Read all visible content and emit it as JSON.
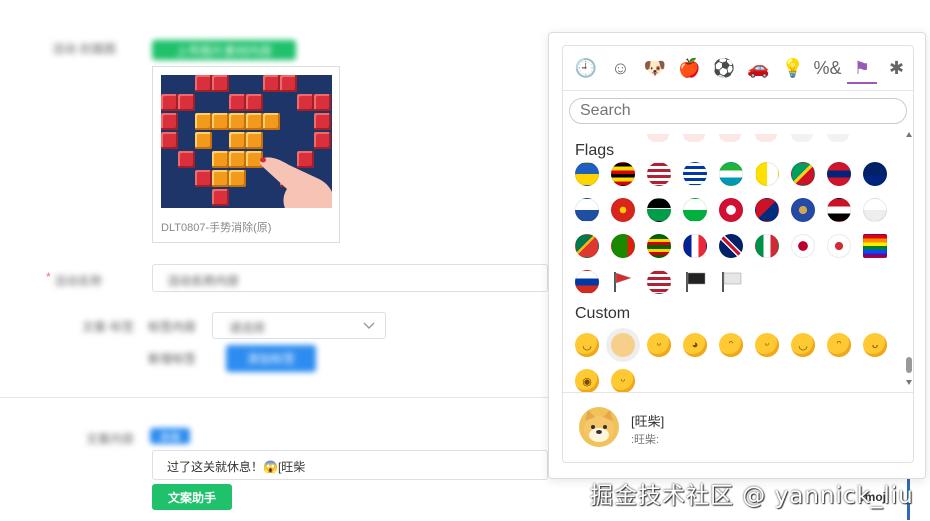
{
  "form": {
    "row1_label": "活动·封面图",
    "row1_button": "上传图片素材内容",
    "card_caption": "DLT0807-手势消除(原)",
    "row2_label": "活动名称",
    "row2_value": "活动名称内容",
    "row3_label": "文案·标签",
    "row3_text": "标签内容",
    "row3_select": "请选择",
    "row4_text": "新增标签",
    "row4_button": "添加标签",
    "row5_label": "文案内容",
    "row5_chip": "表情",
    "textarea_value": "过了这关就休息！😱[旺柴",
    "copy_assist_button": "文案助手",
    "emoji_tag": "emoji"
  },
  "emoji_panel": {
    "search_placeholder": "Search",
    "categories": [
      {
        "name": "recent",
        "glyph": "🕘"
      },
      {
        "name": "smileys",
        "glyph": "☺"
      },
      {
        "name": "animals",
        "glyph": "🐶"
      },
      {
        "name": "food",
        "glyph": "🍎"
      },
      {
        "name": "activity",
        "glyph": "⚽"
      },
      {
        "name": "travel",
        "glyph": "🚗"
      },
      {
        "name": "objects",
        "glyph": "💡"
      },
      {
        "name": "symbols",
        "glyph": "%&"
      },
      {
        "name": "flags",
        "glyph": "⚑"
      },
      {
        "name": "custom",
        "glyph": "✱"
      }
    ],
    "flags_title": "Flags",
    "custom_title": "Custom",
    "preview_name": "[旺柴]",
    "preview_code": ":旺柴:"
  },
  "watermark": "掘金技术社区 @ yannick_liu",
  "colors": {
    "accent": "#9b59b6",
    "green": "#1fc16b",
    "blue": "#2d8cf0"
  }
}
